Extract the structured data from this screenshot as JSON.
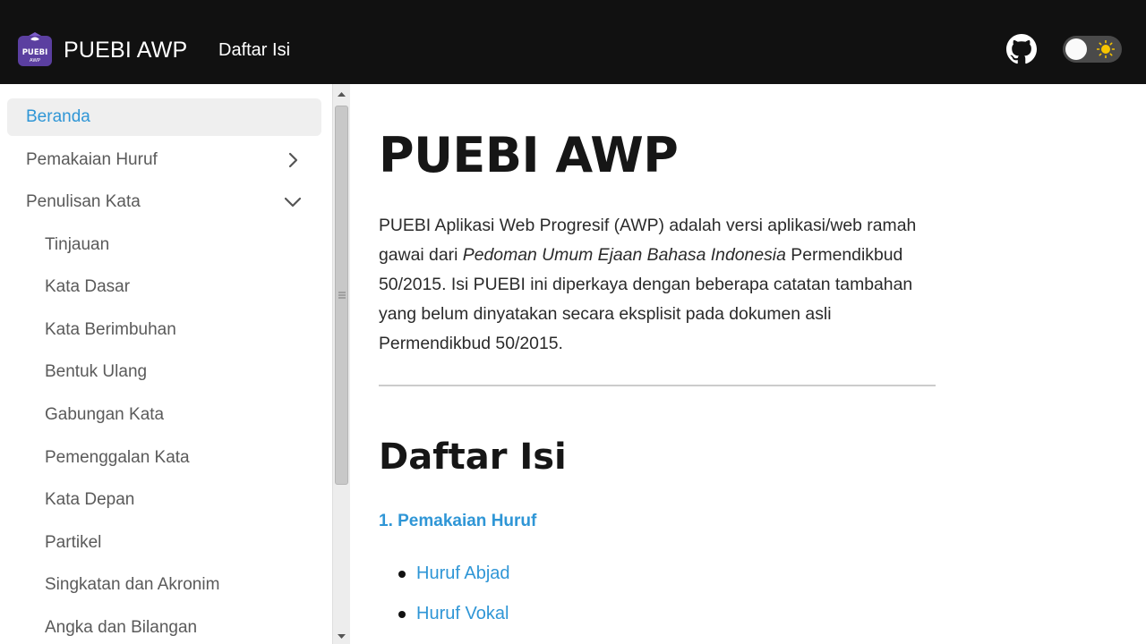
{
  "navbar": {
    "logo_text_top": "PUEBI",
    "logo_text_bottom": "AWP",
    "title": "PUEBI AWP",
    "link": "Daftar Isi",
    "github_icon": "github-icon",
    "theme_icon": "sun-icon"
  },
  "sidebar": {
    "items": [
      {
        "label": "Beranda"
      },
      {
        "label": "Pemakaian Huruf"
      },
      {
        "label": "Penulisan Kata"
      },
      {
        "label": "Tinjauan"
      },
      {
        "label": "Kata Dasar"
      },
      {
        "label": "Kata Berimbuhan"
      },
      {
        "label": "Bentuk Ulang"
      },
      {
        "label": "Gabungan Kata"
      },
      {
        "label": "Pemenggalan Kata"
      },
      {
        "label": "Kata Depan"
      },
      {
        "label": "Partikel"
      },
      {
        "label": "Singkatan dan Akronim"
      },
      {
        "label": "Angka dan Bilangan"
      }
    ]
  },
  "main": {
    "title": "PUEBI AWP",
    "intro_part1": "PUEBI Aplikasi Web Progresif (AWP) adalah versi aplikasi/web ramah gawai dari ",
    "intro_italic": "Pedoman Umum Ejaan Bahasa Indonesia",
    "intro_part2": " Permendikbud 50/2015. Isi PUEBI ini diperkaya dengan beberapa catatan tambahan yang belum dinyatakan secara eksplisit pada dokumen asli Permendikbud 50/2015.",
    "toc_heading": "Daftar Isi",
    "section_link": "1. Pemakaian Huruf",
    "links": [
      "Huruf Abjad",
      "Huruf Vokal"
    ]
  },
  "colors": {
    "navbar_bg": "#111111",
    "accent": "#2f96d6",
    "active_bg": "#efefef"
  }
}
